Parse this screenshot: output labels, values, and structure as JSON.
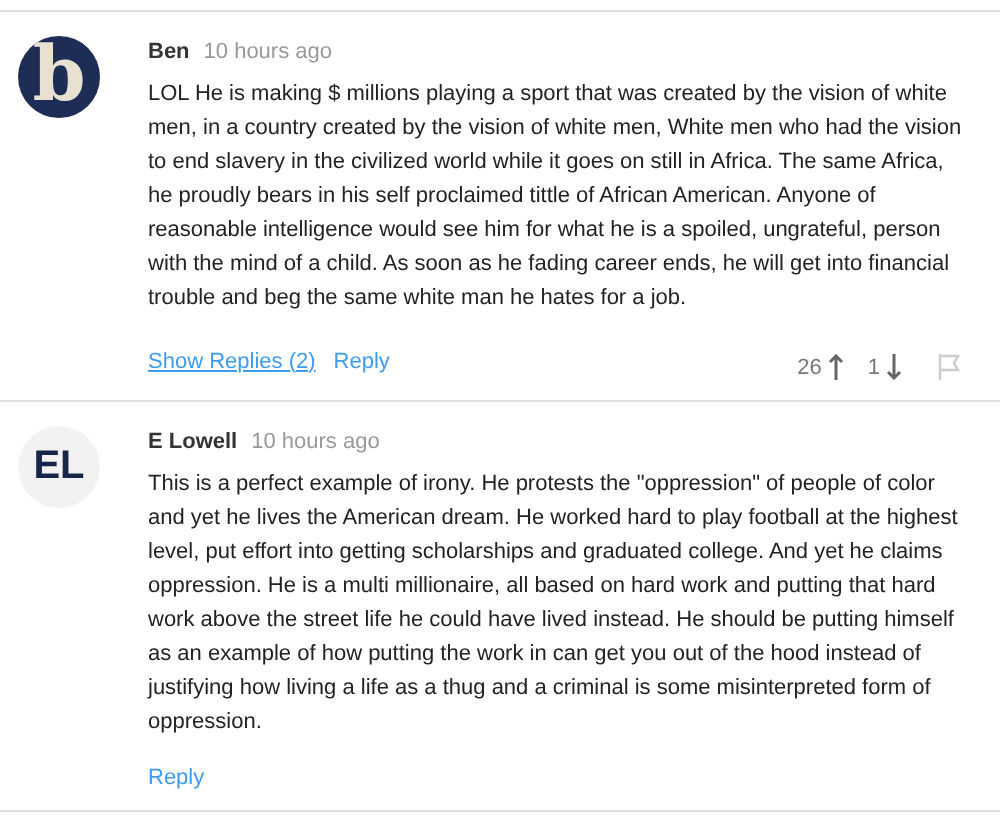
{
  "comments": [
    {
      "avatar": {
        "kind": "dark",
        "text": "b"
      },
      "author": "Ben",
      "time": "10 hours ago",
      "body": "LOL He is making $ millions playing a sport that was created by the vision of white men, in a country created by the vision of white men, White men who had the vision to end slavery in the civilized world while it goes on still in Africa. The same Africa, he proudly bears in his self proclaimed tittle of African American. Anyone of reasonable intelligence would see him for what he is a spoiled, ungrateful, person with the mind of a child. As soon as he fading career ends, he will get into financial trouble and beg the same white man he hates for a job.",
      "show_replies": "Show Replies (2)",
      "reply": "Reply",
      "upvotes": "26",
      "downvotes": "1"
    },
    {
      "avatar": {
        "kind": "light",
        "text": "EL"
      },
      "author": "E Lowell",
      "time": "10 hours ago",
      "body": "This is a perfect example of irony. He protests the \"oppression\" of people of color and yet he lives the American dream. He worked hard to play football at the highest level, put effort into getting scholarships and graduated college. And yet he claims oppression. He is a multi millionaire, all based on hard work and putting that hard work above the street life he could have lived instead. He should be putting himself as an example of how putting the work in can get you out of the hood instead of justifying how living a life as a thug and a criminal is some misinterpreted form of oppression.",
      "reply": "Reply"
    }
  ]
}
